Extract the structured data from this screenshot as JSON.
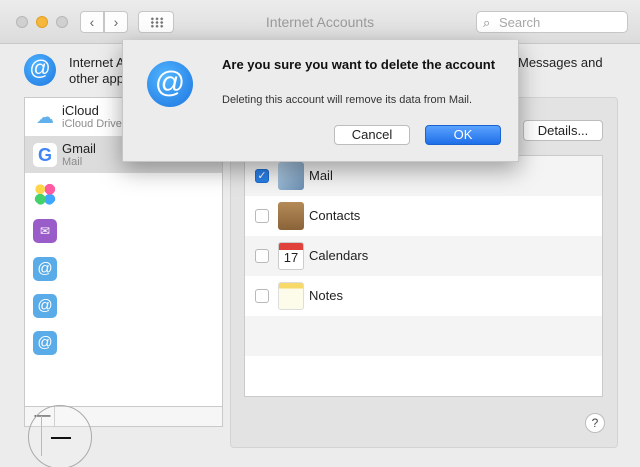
{
  "window": {
    "title": "Internet Accounts",
    "search_placeholder": "Search",
    "nav_back": "‹",
    "nav_forward": "›"
  },
  "header": {
    "text_left_line1": "Internet A",
    "text_left_line2": "other app",
    "text_right": "Messages and"
  },
  "accounts": [
    {
      "name": "iCloud",
      "sub": "iCloud Drive",
      "icon": "icloud-icon"
    },
    {
      "name": "Gmail",
      "sub": "Mail",
      "icon": "google-icon",
      "selected": true
    },
    {
      "name": "",
      "sub": "",
      "icon": "game-center-icon"
    },
    {
      "name": "",
      "sub": "",
      "icon": "mail-envelope-icon"
    },
    {
      "name": "",
      "sub": "",
      "icon": "at-icon"
    },
    {
      "name": "",
      "sub": "",
      "icon": "at-icon"
    },
    {
      "name": "",
      "sub": "",
      "icon": "at-icon"
    }
  ],
  "sidebar_footer": {
    "remove": "—"
  },
  "details_button": "Details...",
  "services": [
    {
      "label": "Mail",
      "checked": true,
      "icon": "mail-app-icon"
    },
    {
      "label": "Contacts",
      "checked": false,
      "icon": "contacts-app-icon"
    },
    {
      "label": "Calendars",
      "checked": false,
      "icon": "calendar-app-icon",
      "date": "17"
    },
    {
      "label": "Notes",
      "checked": false,
      "icon": "notes-app-icon"
    }
  ],
  "help": "?",
  "dialog": {
    "title": "Are you sure you want to delete the account",
    "message": "Deleting this account will remove its data from Mail.",
    "cancel": "Cancel",
    "ok": "OK"
  },
  "colors": {
    "accent": "#2a7fe6",
    "minimize": "#f6b73c",
    "selected_row": "#dcdcdc"
  }
}
